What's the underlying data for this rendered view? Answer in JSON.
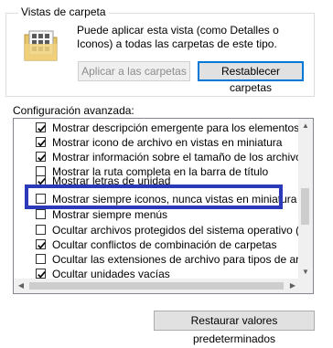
{
  "group": {
    "title": "Vistas de carpeta",
    "description": "Puede aplicar esta vista (como Detalles o Iconos) a todas las carpetas de este tipo.",
    "apply_label": "Aplicar a las carpetas",
    "reset_label": "Restablecer carpetas"
  },
  "advanced": {
    "label": "Configuración avanzada:",
    "items": [
      {
        "label": "Mostrar descripción emergente para los elementos de carpetas y escritorio",
        "checked": true
      },
      {
        "label": "Mostrar icono de archivo en vistas en miniatura",
        "checked": true
      },
      {
        "label": "Mostrar información sobre el tamaño de los archivos en sugerencias de carpetas",
        "checked": true
      },
      {
        "label": "Mostrar la ruta completa en la barra de título",
        "checked": false
      },
      {
        "label": "Mostrar letras de unidad",
        "checked": true
      },
      {
        "label": "Mostrar siempre iconos, nunca vistas en miniatura",
        "checked": false
      },
      {
        "label": "Mostrar siempre menús",
        "checked": false
      },
      {
        "label": "Ocultar archivos protegidos del sistema operativo (recomendado)",
        "checked": false
      },
      {
        "label": "Ocultar conflictos de combinación de carpetas",
        "checked": true
      },
      {
        "label": "Ocultar las extensiones de archivo para tipos de archivo conocidos",
        "checked": false
      },
      {
        "label": "Ocultar unidades vacías",
        "checked": true
      }
    ]
  },
  "restore_label": "Restaurar valores predeterminados",
  "colors": {
    "highlight": "#2a3ab8",
    "focus": "#0078d7"
  }
}
